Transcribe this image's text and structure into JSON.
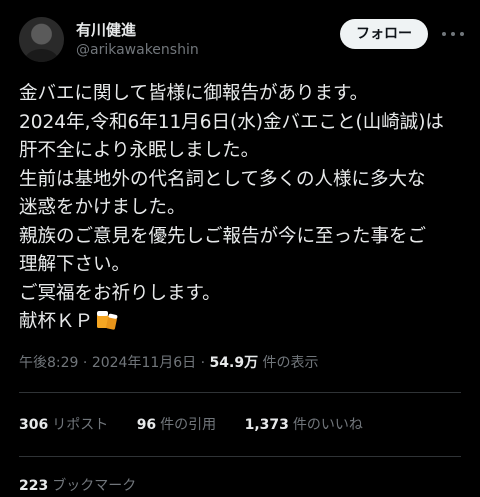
{
  "author": {
    "display_name": "有川健進",
    "handle": "@arikawakenshin"
  },
  "follow_button_label": "フォロー",
  "tweet": {
    "lines": [
      "金バエに関して皆様に御報告があります。",
      "2024年,令和6年11月6日(水)金バエこと(山崎誠)は",
      "肝不全により永眠しました。",
      "生前は基地外の代名詞として多くの人様に多大な",
      "迷惑をかけました。",
      "親族のご意見を優先しご報告が今に至った事をご",
      "理解下さい。",
      "ご冥福をお祈りします。",
      "献杯ＫＰ"
    ]
  },
  "meta": {
    "time": "午後8:29",
    "separator": "·",
    "date": "2024年11月6日",
    "views_count": "54.9万",
    "views_label": "件の表示"
  },
  "stats": {
    "reposts_count": "306",
    "reposts_label": "リポスト",
    "quotes_count": "96",
    "quotes_label": "件の引用",
    "likes_count": "1,373",
    "likes_label": "件のいいね",
    "bookmarks_count": "223",
    "bookmarks_label": "ブックマーク"
  },
  "icons": [
    "more-icon",
    "beer-icon"
  ],
  "colors": {
    "background": "#000000",
    "text": "#e7e9ea",
    "secondary_text": "#71767b",
    "follow_button_bg": "#eff3f4",
    "divider": "#2f3336"
  }
}
